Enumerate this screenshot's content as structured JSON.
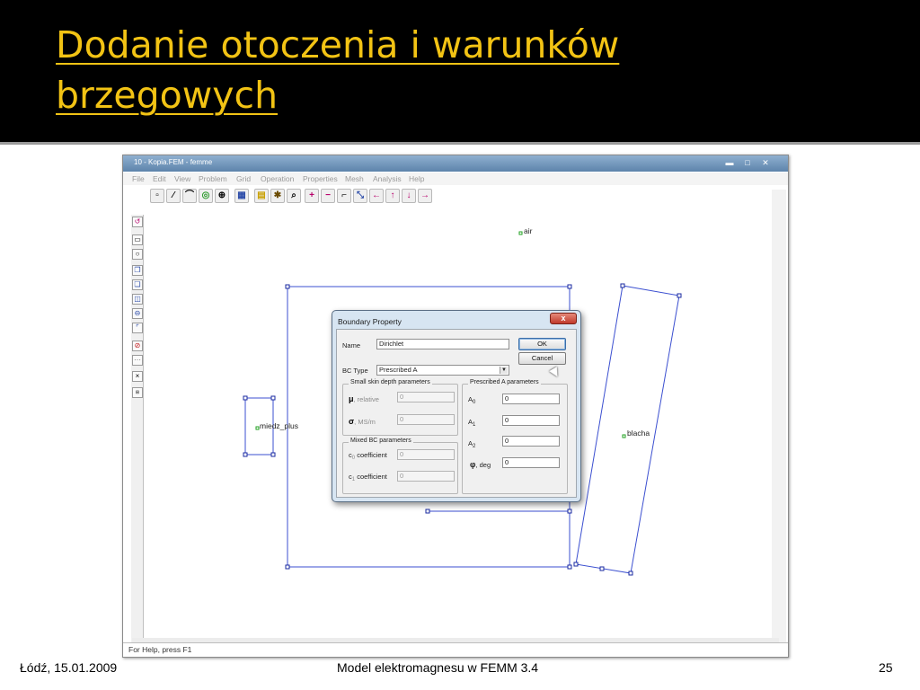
{
  "slide": {
    "title_line1": "Dodanie otoczenia i warunków",
    "title_line2": "brzegowych",
    "footer_left": "Łódź, 15.01.2009",
    "footer_center": "Model elektromagnesu w FEMM 3.4",
    "footer_right": "25",
    "title_color": "#f2c314",
    "background_color": "#000000"
  },
  "window": {
    "title": "10 - Kopia.FEM - femme",
    "menu": [
      "File",
      "Edit",
      "View",
      "Problem",
      "Grid",
      "Operation",
      "Properties",
      "Mesh",
      "Analysis",
      "Help"
    ],
    "status": "For Help, press F1"
  },
  "toolbar": {
    "icons": [
      "node-icon",
      "segment-icon",
      "arc-icon",
      "block-label-icon",
      "group-icon",
      "table-icon",
      "folder-icon",
      "mesh-icon",
      "zoom-icon",
      "plus-icon",
      "minus-icon",
      "zoom-box-icon",
      "zoom-natural-icon",
      "arrow-left-icon",
      "arrow-up-icon",
      "arrow-down-icon",
      "arrow-right-icon"
    ]
  },
  "sidebar": {
    "icons": [
      "undo-icon",
      "select-icon",
      "circle-icon",
      "copy-icon",
      "move-icon",
      "mirror-icon",
      "scale-icon",
      "snap-icon",
      "delete-icon",
      "grid-icon",
      "cross-icon",
      "grid-size-icon"
    ]
  },
  "canvas": {
    "labels": {
      "air": "air",
      "miedz": "miedz_plus",
      "blacha": "blacha"
    }
  },
  "dialog": {
    "title": "Boundary Property",
    "close": "x",
    "name_label": "Name",
    "name_value": "Dirichlet",
    "ok": "OK",
    "cancel": "Cancel",
    "bc_type_label": "BC Type",
    "bc_type_value": "Prescribed A",
    "small_skin_group": "Small skin depth parameters",
    "mu_label": ", relative",
    "mu_value": "0",
    "sigma_label": ", MS/m",
    "sigma_value": "0",
    "mixed_group": "Mixed BC parameters",
    "c0_label": "coefficient",
    "c0_value": "0",
    "c1_label": "coefficient",
    "c1_value": "0",
    "prescribed_group": "Prescribed A parameters",
    "a0_value": "0",
    "a1_value": "0",
    "a2_value": "0",
    "phi_label": ", deg",
    "phi_value": "0",
    "mu_symbol": "μ",
    "sigma_symbol": "σ",
    "phi_symbol": "φ",
    "a_letter": "A",
    "c_letter": "c",
    "sub0": "0",
    "sub1": "1",
    "sub2": "2"
  }
}
